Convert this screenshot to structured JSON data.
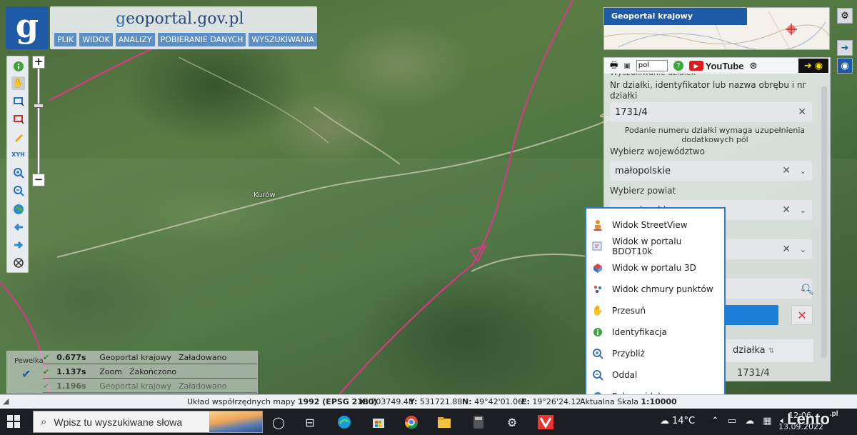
{
  "header": {
    "logo_glyph": "g",
    "site_title_g": "g",
    "site_title_rest": "eoportal.gov.pl",
    "menu": [
      "PLIK",
      "WIDOK",
      "ANALIZY",
      "POBIERANIE DANYCH",
      "WYSZUKIWANIA"
    ]
  },
  "map": {
    "village_label": "Kurów",
    "accent_line_color": "#e0338a"
  },
  "zoom": {
    "plus": "+",
    "minus": "−"
  },
  "log": {
    "label": "Pewelka",
    "rows": [
      {
        "time": "0.677s",
        "source": "Geoportal krajowy",
        "status": "Załadowano"
      },
      {
        "time": "1.137s",
        "source": "Zoom",
        "status": "Zakończono"
      },
      {
        "time": "1.196s",
        "source": "Geoportal krajowy",
        "status": "Załadowano"
      }
    ]
  },
  "overview": {
    "title": "Geoportal krajowy"
  },
  "panel": {
    "lang": "pol",
    "youtube": "YouTube",
    "heading": "Wyszukiwanie działek",
    "search_label": "Nr działki, identyfikator lub nazwa obrębu i nr działki",
    "search_value": "1731/4",
    "hint": "Podanie numeru działki wymaga uzupełnienia dodatkowych pól",
    "voivodeship_label": "Wybierz województwo",
    "voivodeship_value": "małopolskie",
    "county_label": "Wybierz powiat",
    "county_value": "nowotarski",
    "table_header": "działka",
    "table_value": "1731/4"
  },
  "context_menu": {
    "items": [
      {
        "label": "Widok StreetView",
        "icon": "person-icon"
      },
      {
        "label": "Widok w portalu BDOT10k",
        "icon": "map-icon"
      },
      {
        "label": "Widok w portalu 3D",
        "icon": "cube-icon"
      },
      {
        "label": "Widok chmury punktów",
        "icon": "points-icon"
      },
      {
        "label": "Przesuń",
        "icon": "hand-icon"
      },
      {
        "label": "Identyfikacja",
        "icon": "info-icon"
      },
      {
        "label": "Przybliż",
        "icon": "zoom-in-icon"
      },
      {
        "label": "Oddal",
        "icon": "zoom-out-icon"
      },
      {
        "label": "Pełny widok",
        "icon": "globe-icon"
      }
    ]
  },
  "coords": {
    "label": "Układ współrzędnych mapy",
    "system": "1992 (EPSG 2180)",
    "x_label": "X:",
    "x_value": "203749.48",
    "y_label": "Y:",
    "y_value": "531721.88",
    "n_label": "N:",
    "n_value": "49°42'01.06\"",
    "e_label": "E:",
    "e_value": "19°26'24.12\"",
    "scale_label": "Aktualna Skala",
    "scale_value": "1:10000"
  },
  "taskbar": {
    "search_placeholder": "Wpisz tu wyszukiwane słowa",
    "temperature": "14°C",
    "time": "12:06",
    "date": "13.09.2022",
    "watermark": "Lento",
    "watermark_suffix": ".pl"
  }
}
